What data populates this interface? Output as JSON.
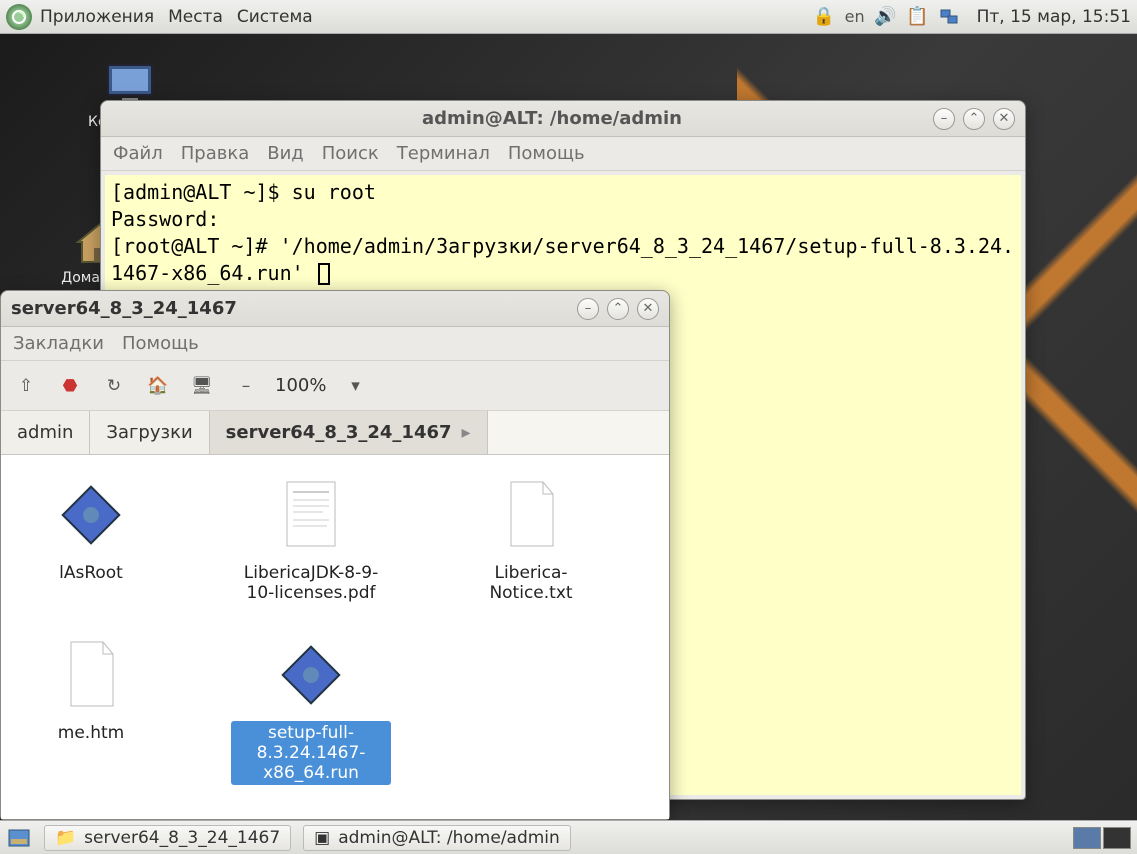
{
  "panel": {
    "menus": [
      "Приложения",
      "Места",
      "Система"
    ],
    "lang": "en",
    "clock": "Пт, 15 мар, 15:51"
  },
  "desktop": {
    "computer": "Компьютер",
    "home": "Домашняя"
  },
  "terminal": {
    "title": "admin@ALT: /home/admin",
    "menus": [
      "Файл",
      "Правка",
      "Вид",
      "Поиск",
      "Терминал",
      "Помощь"
    ],
    "content": "[admin@ALT ~]$ su root\nPassword:\n[root@ALT ~]# '/home/admin/Загрузки/server64_8_3_24_1467/setup-full-8.3.24.1467-x86_64.run' "
  },
  "filemanager": {
    "title": "server64_8_3_24_1467",
    "menus": [
      "Закладки",
      "Помощь"
    ],
    "zoom": "100%",
    "path": [
      "admin",
      "Загрузки",
      "server64_8_3_24_1467"
    ],
    "files": [
      {
        "name": "lAsRoot",
        "type": "exec",
        "selected": false
      },
      {
        "name": "LibericaJDK-8-9-10-licenses.pdf",
        "type": "pdf",
        "selected": false
      },
      {
        "name": "Liberica-Notice.txt",
        "type": "txt",
        "selected": false
      },
      {
        "name": "me.htm",
        "type": "htm",
        "selected": false
      },
      {
        "name": "setup-full-8.3.24.1467-x86_64.run",
        "type": "exec",
        "selected": true
      }
    ]
  },
  "taskbar": {
    "tasks": [
      {
        "icon": "folder",
        "label": "server64_8_3_24_1467"
      },
      {
        "icon": "terminal",
        "label": "admin@ALT: /home/admin"
      }
    ]
  }
}
